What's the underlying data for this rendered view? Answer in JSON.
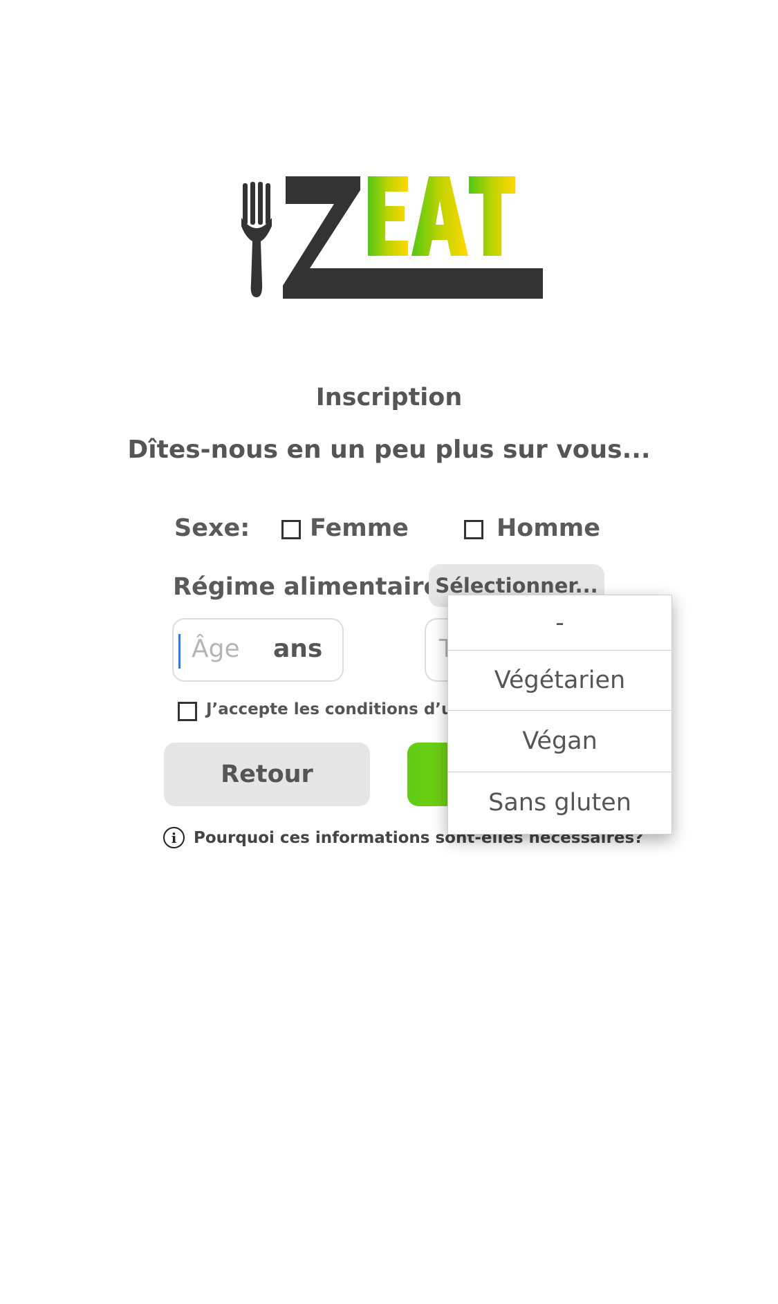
{
  "logo": {
    "text": "ZEAT",
    "name": "zeat-logo"
  },
  "page": {
    "title": "Inscription",
    "subtitle": "Dîtes-nous en un peu plus sur vous..."
  },
  "sexe": {
    "label": "Sexe:",
    "options": [
      {
        "label": "Femme",
        "checked": false
      },
      {
        "label": "Homme",
        "checked": false
      }
    ]
  },
  "regime": {
    "label": "Régime alimentaire:",
    "select_label": "Sélectionner...",
    "options": [
      "-",
      "Végétarien",
      "Végan",
      "Sans gluten"
    ]
  },
  "age": {
    "placeholder": "Âge",
    "unit": "ans"
  },
  "taille": {
    "placeholder_visible": "T"
  },
  "terms": {
    "label": "J’accepte les conditions d’util",
    "checked": false
  },
  "buttons": {
    "back": "Retour"
  },
  "info": {
    "icon_glyph": "i",
    "text": "Pourquoi ces informations sont-elles nécessaires?"
  },
  "colors": {
    "accent_green": "#66cc11",
    "accent_yellow": "#f5d800",
    "caret_blue": "#2a7be4"
  }
}
